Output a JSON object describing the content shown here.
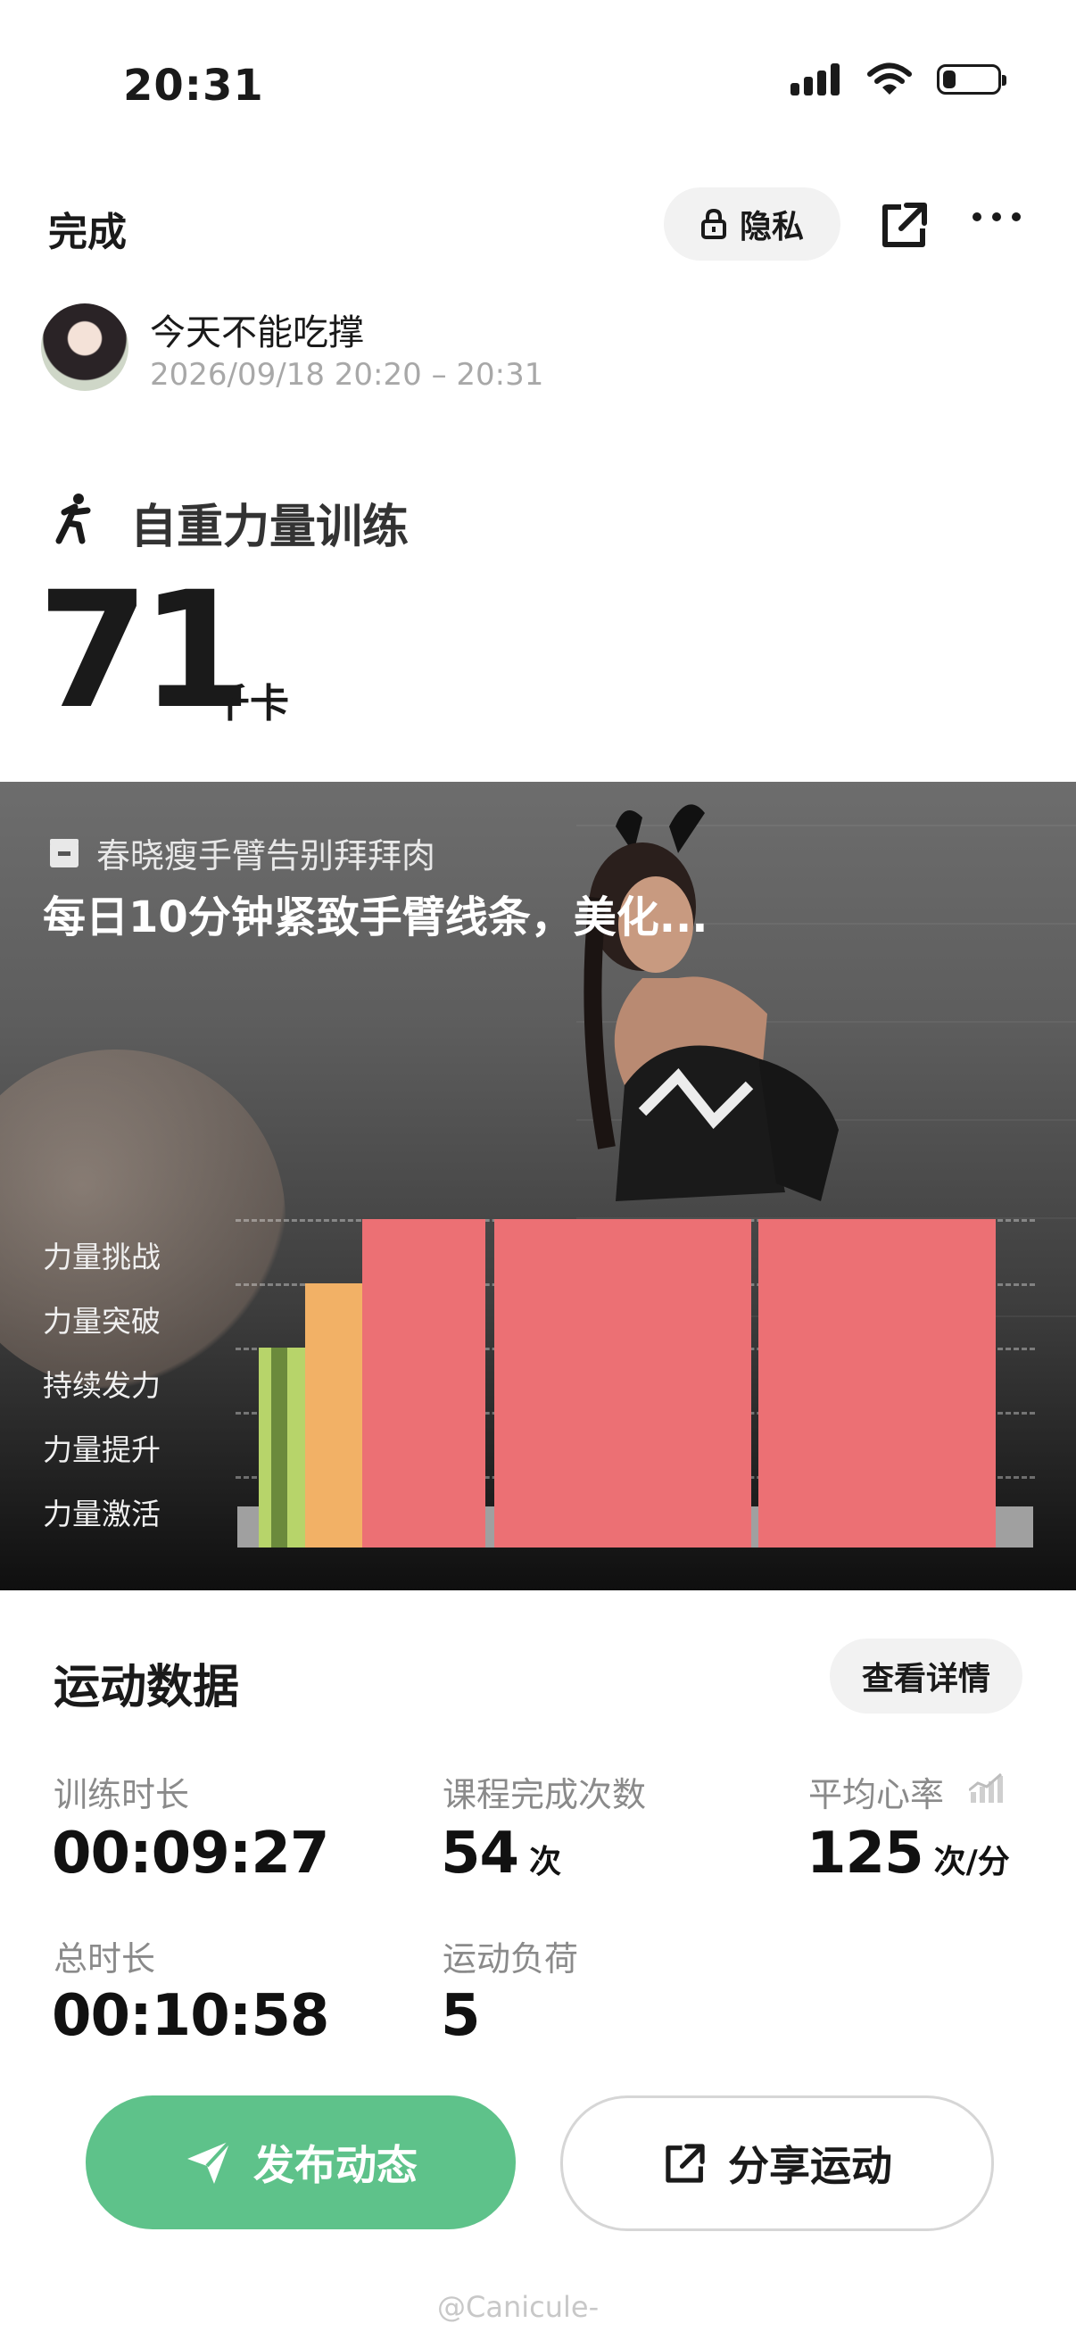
{
  "status_bar": {
    "time": "20:31"
  },
  "header": {
    "done_label": "完成",
    "privacy_label": "隐私"
  },
  "user": {
    "name": "今天不能吃撑",
    "time_range": "2026/09/18 20:20 – 20:31"
  },
  "workout": {
    "type": "自重力量训练",
    "calories": "71",
    "calories_unit": "千卡"
  },
  "course": {
    "name": "春晓瘦手臂告别拜拜肉",
    "description": "每日10分钟紧致手臂线条，美化...",
    "zones": [
      "力量挑战",
      "力量突破",
      "持续发力",
      "力量提升",
      "力量激活"
    ],
    "zone_colors": [
      "#ec7074",
      "#f2b166",
      "#b7d46a",
      "#6b8a3c",
      "#a0a0a0"
    ]
  },
  "stats": {
    "section_title": "运动数据",
    "detail_button": "查看详情",
    "items": [
      {
        "label": "训练时长",
        "value": "00:09:27",
        "unit": ""
      },
      {
        "label": "课程完成次数",
        "value": "54",
        "unit": "次"
      },
      {
        "label": "平均心率",
        "value": "125",
        "unit": "次/分"
      },
      {
        "label": "总时长",
        "value": "00:10:58",
        "unit": ""
      },
      {
        "label": "运动负荷",
        "value": "5",
        "unit": ""
      }
    ]
  },
  "actions": {
    "publish_label": "发布动态",
    "share_label": "分享运动"
  },
  "watermark": "@Canicule-",
  "icons": [
    "lock-icon",
    "share-icon",
    "more-icon",
    "workout-person-icon",
    "course-icon",
    "heart-rate-icon",
    "send-icon",
    "signal-icon",
    "wifi-icon",
    "battery-icon"
  ]
}
